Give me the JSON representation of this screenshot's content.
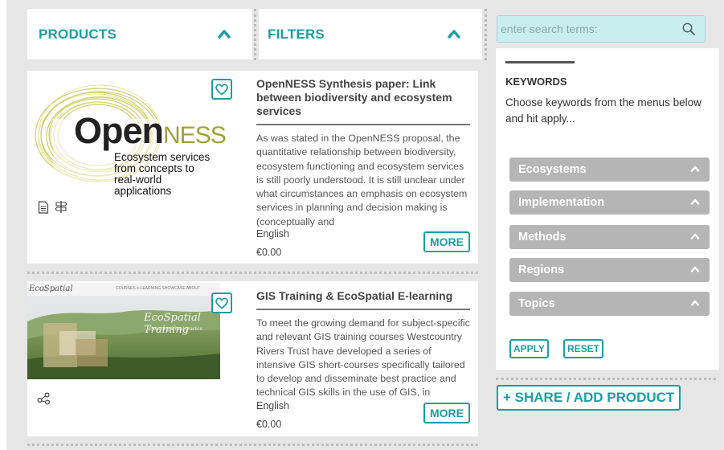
{
  "header": {
    "products_label": "PRODUCTS",
    "filters_label": "FILTERS"
  },
  "products": [
    {
      "title": "OpenNESS Synthesis paper: Link between biodiversity and ecosystem services",
      "description": "As was stated in the OpenNESS proposal, the quantitative relationship between biodiversity, ecosystem functioning and ecosystem services is still poorly understood. It is still unclear under what circumstances an emphasis on ecosystem services in planning and decision making is (conceptually and",
      "language": "English",
      "price": "€0.00",
      "more_label": "MORE",
      "logo": {
        "brand_a": "Open",
        "brand_b": "NESS",
        "tagline_1": "Ecosystem services",
        "tagline_2": "from concepts to",
        "tagline_3": "real-world applications"
      },
      "icons": [
        "document-icon",
        "signpost-icon"
      ]
    },
    {
      "title": "GIS Training & EcoSpatial E-learning",
      "description": "To meet the growing demand for subject-specific and relevant GIS training courses Westcountry Rivers Trust have developed a series of intensive GIS short-courses specifically tailored to develop and disseminate best practice and technical GIS skills in the use of GIS, in practitioners engaged in",
      "language": "English",
      "price": "€0.00",
      "more_label": "MORE",
      "thumb": {
        "site_name": "EcoSpatial",
        "nav_text": "COURSES  e-LEARNING  SHOWCASE  ABOUT",
        "banner_title": "EcoSpatial Training",
        "banner_sub": "e-learning & best practice"
      },
      "icons": [
        "share-icon"
      ]
    }
  ],
  "search": {
    "placeholder": "enter search terms:"
  },
  "keywords": {
    "heading": "KEYWORDS",
    "instructions": "Choose keywords from the menus below and hit apply...",
    "categories": [
      "Ecosystems",
      "Implementation",
      "Methods",
      "Regions",
      "Topics"
    ],
    "apply_label": "APPLY",
    "reset_label": "RESET"
  },
  "share_label": "+ SHARE / ADD PRODUCT",
  "colors": {
    "accent": "#1a9fa3",
    "background": "#e6e6e6",
    "accordion": "#b5b5b5"
  }
}
